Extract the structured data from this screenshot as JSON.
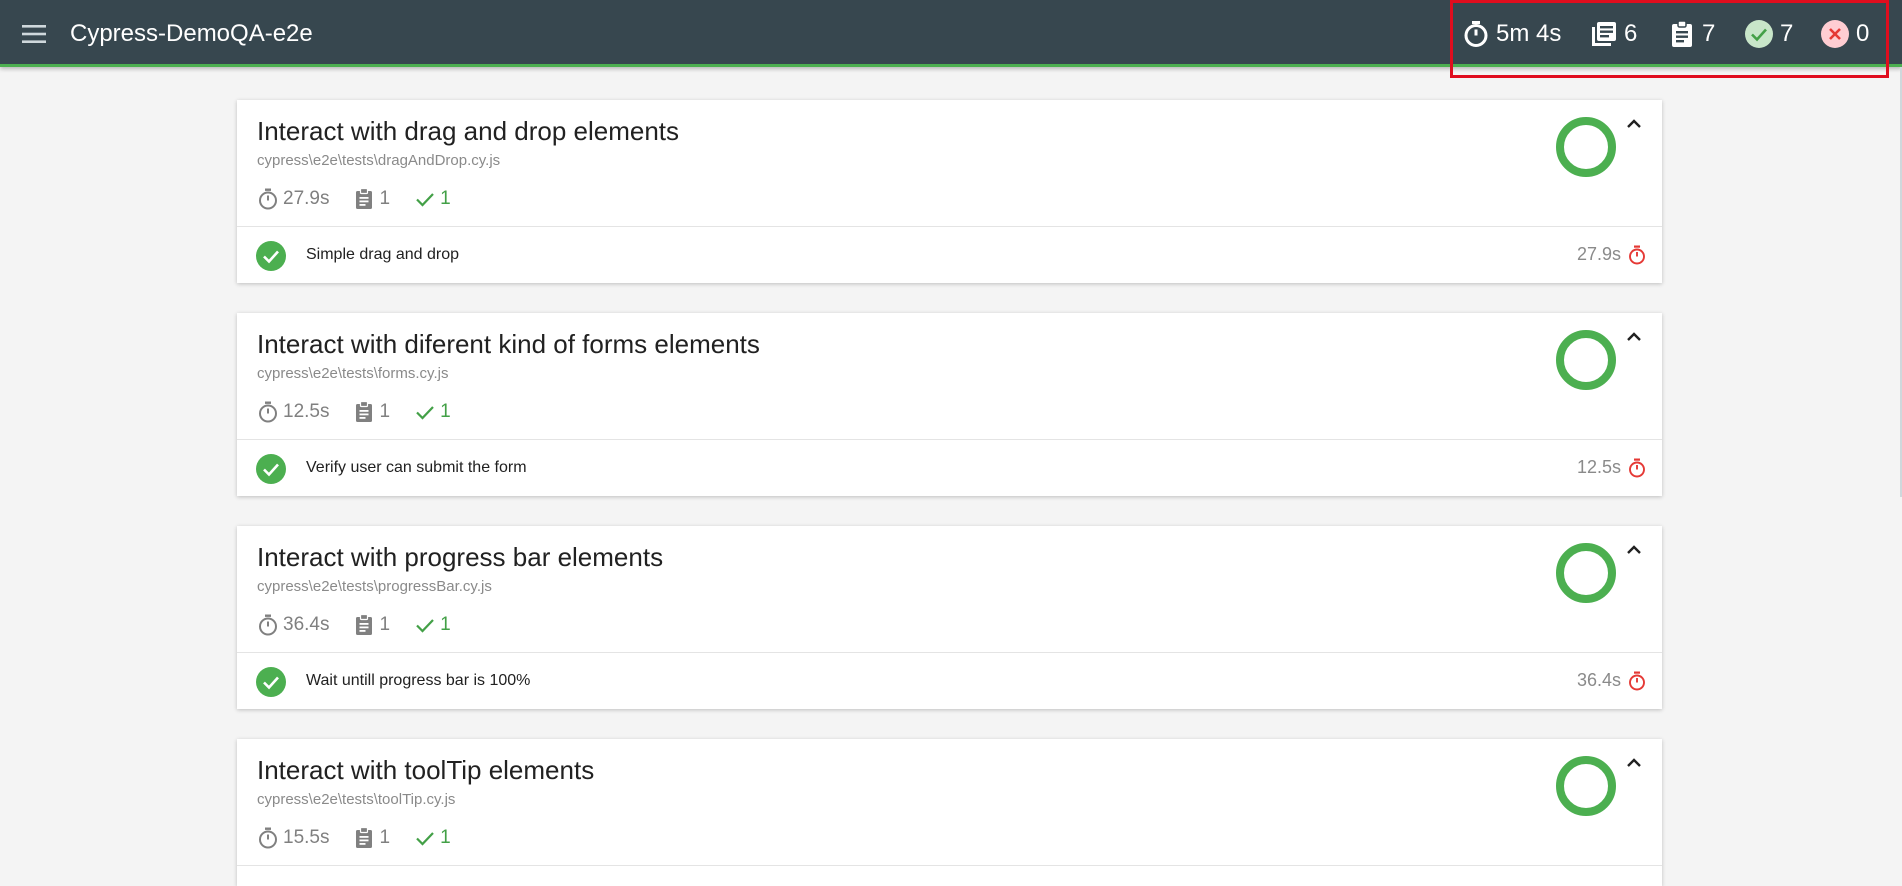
{
  "app": {
    "title": "Cypress-DemoQA-e2e"
  },
  "stats": {
    "duration": "5m 4s",
    "suites": "6",
    "tests": "7",
    "passed": "7",
    "failed": "0"
  },
  "colors": {
    "navbar": "#37474f",
    "accent_green": "#4caf50",
    "failed_red": "#e53935",
    "highlight": "#e00d1e"
  },
  "suites": [
    {
      "title": "Interact with drag and drop elements",
      "file": "cypress\\e2e\\tests\\dragAndDrop.cy.js",
      "duration": "27.9s",
      "tests": "1",
      "passed": "1",
      "test": {
        "name": "Simple drag and drop",
        "duration": "27.9s"
      }
    },
    {
      "title": "Interact with diferent kind of forms elements",
      "file": "cypress\\e2e\\tests\\forms.cy.js",
      "duration": "12.5s",
      "tests": "1",
      "passed": "1",
      "test": {
        "name": "Verify user can submit the form",
        "duration": "12.5s"
      }
    },
    {
      "title": "Interact with progress bar elements",
      "file": "cypress\\e2e\\tests\\progressBar.cy.js",
      "duration": "36.4s",
      "tests": "1",
      "passed": "1",
      "test": {
        "name": "Wait untill progress bar is 100%",
        "duration": "36.4s"
      }
    },
    {
      "title": "Interact with toolTip elements",
      "file": "cypress\\e2e\\tests\\toolTip.cy.js",
      "duration": "15.5s",
      "tests": "1",
      "passed": "1"
    }
  ]
}
